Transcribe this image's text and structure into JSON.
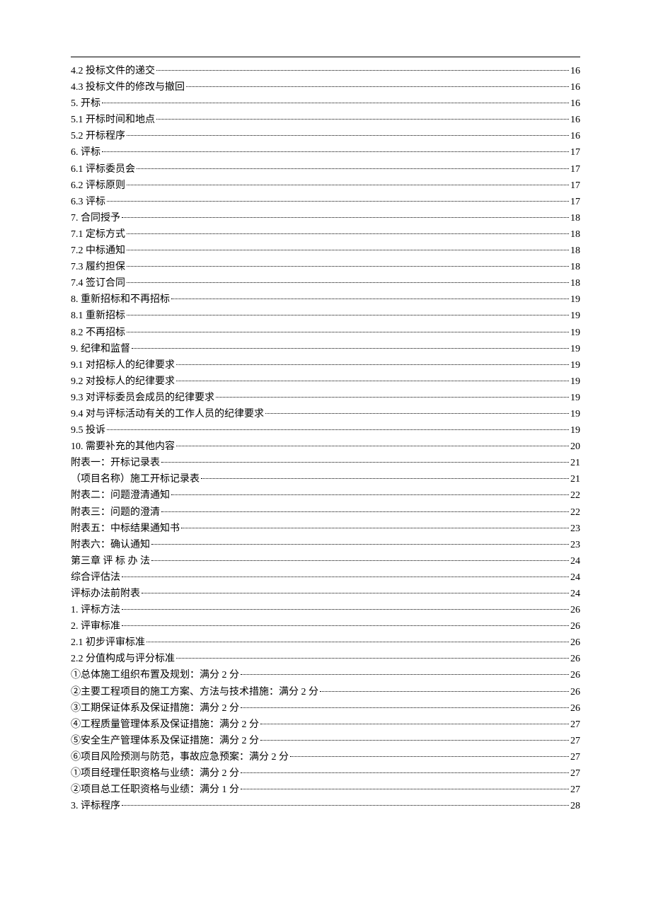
{
  "toc": [
    {
      "label": "4.2 投标文件的递交",
      "page": "16"
    },
    {
      "label": "4.3 投标文件的修改与撤回",
      "page": "16"
    },
    {
      "label": "5. 开标",
      "page": "16"
    },
    {
      "label": "5.1 开标时间和地点",
      "page": "16"
    },
    {
      "label": "5.2 开标程序",
      "page": "16"
    },
    {
      "label": "6. 评标",
      "page": "17"
    },
    {
      "label": "6.1 评标委员会",
      "page": "17"
    },
    {
      "label": "6.2 评标原则",
      "page": "17"
    },
    {
      "label": "6.3 评标",
      "page": "17"
    },
    {
      "label": "7. 合同授予",
      "page": "18"
    },
    {
      "label": "7.1 定标方式",
      "page": "18"
    },
    {
      "label": "7.2 中标通知",
      "page": "18"
    },
    {
      "label": "7.3 履约担保",
      "page": "18"
    },
    {
      "label": "7.4 签订合同",
      "page": "18"
    },
    {
      "label": "8. 重新招标和不再招标",
      "page": "19"
    },
    {
      "label": "8.1 重新招标",
      "page": "19"
    },
    {
      "label": "8.2 不再招标",
      "page": "19"
    },
    {
      "label": "9. 纪律和监督",
      "page": "19"
    },
    {
      "label": "9.1 对招标人的纪律要求",
      "page": "19"
    },
    {
      "label": "9.2 对投标人的纪律要求",
      "page": "19"
    },
    {
      "label": "9.3 对评标委员会成员的纪律要求",
      "page": "19"
    },
    {
      "label": "9.4 对与评标活动有关的工作人员的纪律要求",
      "page": "19"
    },
    {
      "label": "9.5 投诉",
      "page": "19"
    },
    {
      "label": "10. 需要补充的其他内容",
      "page": "20"
    },
    {
      "label": "附表一：开标记录表",
      "page": "21"
    },
    {
      "label": "（项目名称）施工开标记录表",
      "page": "21"
    },
    {
      "label": "附表二：问题澄清通知",
      "page": "22"
    },
    {
      "label": "附表三：问题的澄清",
      "page": "22"
    },
    {
      "label": "附表五：中标结果通知书",
      "page": "23"
    },
    {
      "label": "附表六：确认通知",
      "page": "23"
    },
    {
      "label": "第三章  评 标 办 法",
      "page": "24"
    },
    {
      "label": "综合评估法",
      "page": "24"
    },
    {
      "label": "评标办法前附表",
      "page": "24"
    },
    {
      "label": "1. 评标方法",
      "page": "26"
    },
    {
      "label": "2. 评审标准",
      "page": "26"
    },
    {
      "label": "2.1 初步评审标准",
      "page": "26"
    },
    {
      "label": "2.2 分值构成与评分标准",
      "page": "26"
    },
    {
      "label": "①总体施工组织布置及规划：满分 2 分",
      "page": "26"
    },
    {
      "label": "②主要工程项目的施工方案、方法与技术措施：满分 2 分",
      "page": "26"
    },
    {
      "label": "③工期保证体系及保证措施：满分 2 分",
      "page": "26"
    },
    {
      "label": "④工程质量管理体系及保证措施：满分 2 分",
      "page": "27"
    },
    {
      "label": "⑤安全生产管理体系及保证措施：满分 2 分",
      "page": "27"
    },
    {
      "label": "⑥项目风险预测与防范，事故应急预案：满分 2 分",
      "page": "27"
    },
    {
      "label": "①项目经理任职资格与业绩：满分 2 分",
      "page": "27"
    },
    {
      "label": "②项目总工任职资格与业绩：满分 1 分",
      "page": "27"
    },
    {
      "label": "3. 评标程序",
      "page": "28"
    }
  ]
}
